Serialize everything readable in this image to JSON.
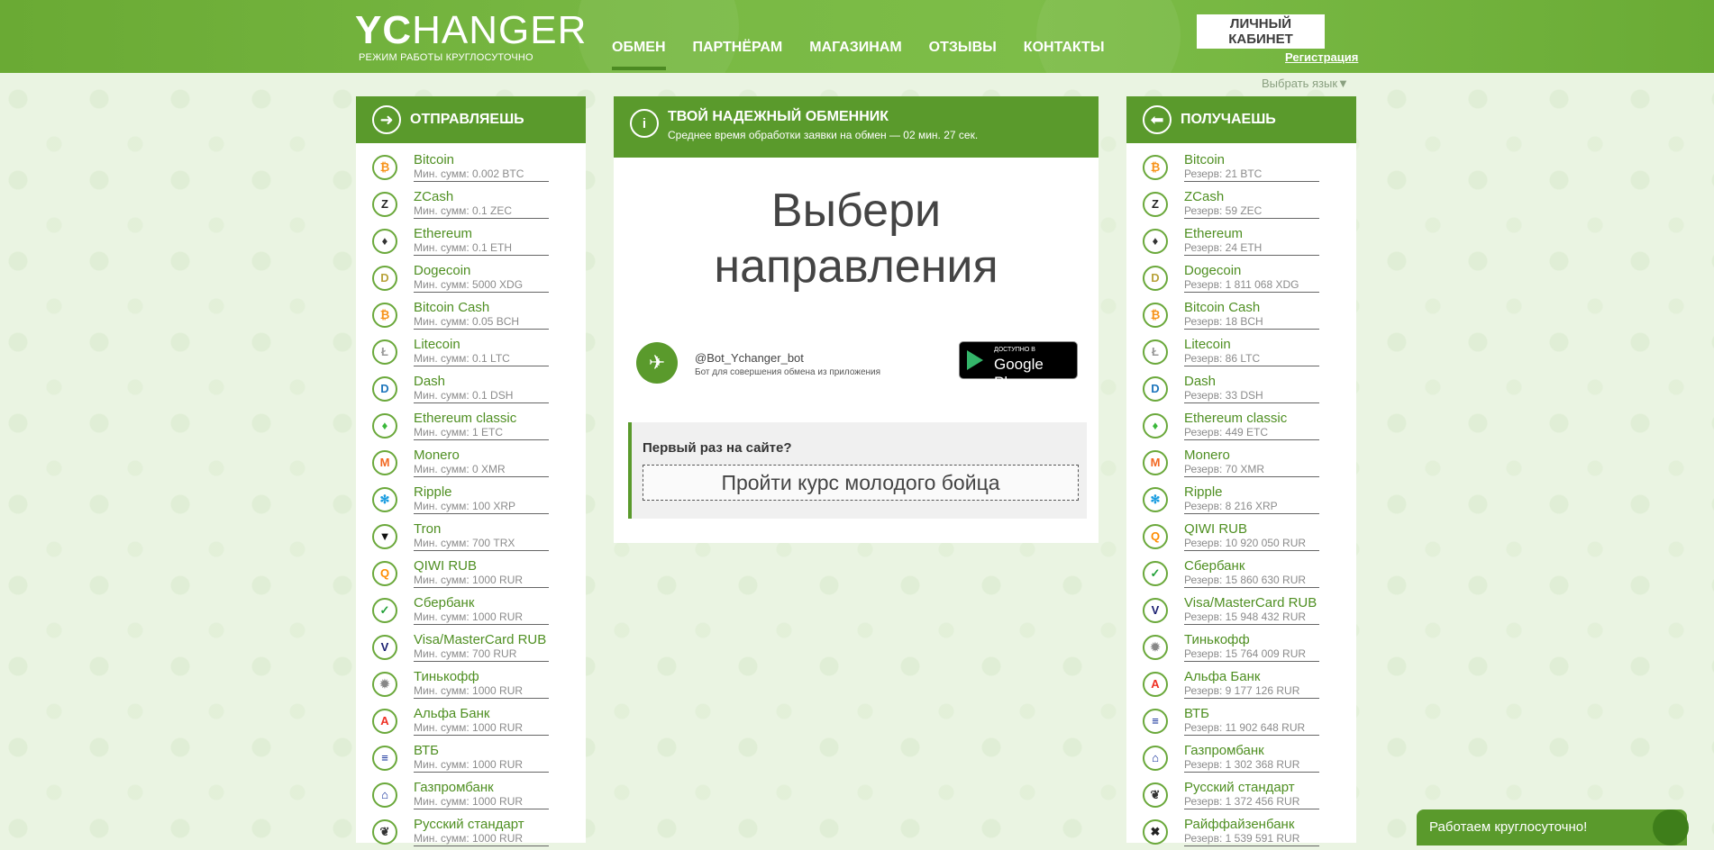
{
  "header": {
    "logo_bold": "YC",
    "logo_rest": "HANGER",
    "tagline": "РЕЖИМ РАБОТЫ КРУГЛОСУТОЧНО",
    "nav": [
      "ОБМЕН",
      "ПАРТНЁРАМ",
      "МАГАЗИНАМ",
      "ОТЗЫВЫ",
      "КОНТАКТЫ"
    ],
    "cabinet": "ЛИЧНЫЙ КАБИНЕТ",
    "register": "Регистрация",
    "lang": "Выбрать язык▼"
  },
  "send": {
    "title": "ОТПРАВЛЯЕШЬ",
    "items": [
      {
        "name": "Bitcoin",
        "sub": "Мин. сумм: 0.002 BTC",
        "icon": "bitcoin-icon",
        "glyph": "₿",
        "color": "#f7931a"
      },
      {
        "name": "ZCash",
        "sub": "Мин. сумм: 0.1 ZEC",
        "icon": "zcash-icon",
        "glyph": "Z",
        "color": "#222222"
      },
      {
        "name": "Ethereum",
        "sub": "Мин. сумм: 0.1 ETH",
        "icon": "ethereum-icon",
        "glyph": "♦",
        "color": "#333333"
      },
      {
        "name": "Dogecoin",
        "sub": "Мин. сумм: 5000 XDG",
        "icon": "dogecoin-icon",
        "glyph": "D",
        "color": "#b8a23a"
      },
      {
        "name": "Bitcoin Cash",
        "sub": "Мин. сумм: 0.05 BCH",
        "icon": "bitcoin-cash-icon",
        "glyph": "₿",
        "color": "#f7931a"
      },
      {
        "name": "Litecoin",
        "sub": "Мин. сумм: 0.1 LTC",
        "icon": "litecoin-icon",
        "glyph": "Ł",
        "color": "#999999"
      },
      {
        "name": "Dash",
        "sub": "Мин. сумм: 0.1 DSH",
        "icon": "dash-icon",
        "glyph": "D",
        "color": "#1c75bc"
      },
      {
        "name": "Ethereum classic",
        "sub": "Мин. сумм: 1 ETC",
        "icon": "ethereum-classic-icon",
        "glyph": "♦",
        "color": "#3ab83a"
      },
      {
        "name": "Monero",
        "sub": "Мин. сумм: 0 XMR",
        "icon": "monero-icon",
        "glyph": "M",
        "color": "#f26822"
      },
      {
        "name": "Ripple",
        "sub": "Мин. сумм: 100 XRP",
        "icon": "ripple-icon",
        "glyph": "✻",
        "color": "#1a9ce0"
      },
      {
        "name": "Tron",
        "sub": "Мин. сумм: 700 TRX",
        "icon": "tron-icon",
        "glyph": "▼",
        "color": "#111111"
      },
      {
        "name": "QIWI RUB",
        "sub": "Мин. сумм: 1000 RUR",
        "icon": "qiwi-icon",
        "glyph": "Q",
        "color": "#ff8c00"
      },
      {
        "name": "Сбербанк",
        "sub": "Мин. сумм: 1000 RUR",
        "icon": "sberbank-icon",
        "glyph": "✓",
        "color": "#21a038"
      },
      {
        "name": "Visa/MasterCard RUB",
        "sub": "Мин. сумм: 700 RUR",
        "icon": "visa-mastercard-icon",
        "glyph": "V",
        "color": "#1a1f71"
      },
      {
        "name": "Тинькофф",
        "sub": "Мин. сумм: 1000 RUR",
        "icon": "tinkoff-icon",
        "glyph": "✹",
        "color": "#888888"
      },
      {
        "name": "Альфа Банк",
        "sub": "Мин. сумм: 1000 RUR",
        "icon": "alfa-bank-icon",
        "glyph": "A",
        "color": "#ef3124"
      },
      {
        "name": "ВТБ",
        "sub": "Мин. сумм: 1000 RUR",
        "icon": "vtb-icon",
        "glyph": "≡",
        "color": "#0a2896"
      },
      {
        "name": "Газпромбанк",
        "sub": "Мин. сумм: 1000 RUR",
        "icon": "gazprombank-icon",
        "glyph": "⌂",
        "color": "#0a2896"
      },
      {
        "name": "Русский стандарт",
        "sub": "Мин. сумм: 1000 RUR",
        "icon": "russian-standard-icon",
        "glyph": "❦",
        "color": "#333333"
      }
    ]
  },
  "receive": {
    "title": "ПОЛУЧАЕШЬ",
    "items": [
      {
        "name": "Bitcoin",
        "sub": "Резерв: 21 BTC",
        "icon": "bitcoin-icon",
        "glyph": "₿",
        "color": "#f7931a"
      },
      {
        "name": "ZCash",
        "sub": "Резерв: 59 ZEC",
        "icon": "zcash-icon",
        "glyph": "Z",
        "color": "#222222"
      },
      {
        "name": "Ethereum",
        "sub": "Резерв: 24 ETH",
        "icon": "ethereum-icon",
        "glyph": "♦",
        "color": "#333333"
      },
      {
        "name": "Dogecoin",
        "sub": "Резерв: 1 811 068 XDG",
        "icon": "dogecoin-icon",
        "glyph": "D",
        "color": "#b8a23a"
      },
      {
        "name": "Bitcoin Cash",
        "sub": "Резерв: 18 BCH",
        "icon": "bitcoin-cash-icon",
        "glyph": "₿",
        "color": "#f7931a"
      },
      {
        "name": "Litecoin",
        "sub": "Резерв: 86 LTC",
        "icon": "litecoin-icon",
        "glyph": "Ł",
        "color": "#999999"
      },
      {
        "name": "Dash",
        "sub": "Резерв: 33 DSH",
        "icon": "dash-icon",
        "glyph": "D",
        "color": "#1c75bc"
      },
      {
        "name": "Ethereum classic",
        "sub": "Резерв: 449 ETC",
        "icon": "ethereum-classic-icon",
        "glyph": "♦",
        "color": "#3ab83a"
      },
      {
        "name": "Monero",
        "sub": "Резерв: 70 XMR",
        "icon": "monero-icon",
        "glyph": "M",
        "color": "#f26822"
      },
      {
        "name": "Ripple",
        "sub": "Резерв: 8 216 XRP",
        "icon": "ripple-icon",
        "glyph": "✻",
        "color": "#1a9ce0"
      },
      {
        "name": "QIWI RUB",
        "sub": "Резерв: 10 920 050 RUR",
        "icon": "qiwi-icon",
        "glyph": "Q",
        "color": "#ff8c00"
      },
      {
        "name": "Сбербанк",
        "sub": "Резерв: 15 860 630 RUR",
        "icon": "sberbank-icon",
        "glyph": "✓",
        "color": "#21a038"
      },
      {
        "name": "Visa/MasterCard RUB",
        "sub": "Резерв: 15 948 432 RUR",
        "icon": "visa-mastercard-icon",
        "glyph": "V",
        "color": "#1a1f71"
      },
      {
        "name": "Тинькофф",
        "sub": "Резерв: 15 764 009 RUR",
        "icon": "tinkoff-icon",
        "glyph": "✹",
        "color": "#888888"
      },
      {
        "name": "Альфа Банк",
        "sub": "Резерв: 9 177 126 RUR",
        "icon": "alfa-bank-icon",
        "glyph": "A",
        "color": "#ef3124"
      },
      {
        "name": "ВТБ",
        "sub": "Резерв: 11 902 648 RUR",
        "icon": "vtb-icon",
        "glyph": "≡",
        "color": "#0a2896"
      },
      {
        "name": "Газпромбанк",
        "sub": "Резерв: 1 302 368 RUR",
        "icon": "gazprombank-icon",
        "glyph": "⌂",
        "color": "#0a2896"
      },
      {
        "name": "Русский стандарт",
        "sub": "Резерв: 1 372 456 RUR",
        "icon": "russian-standard-icon",
        "glyph": "❦",
        "color": "#333333"
      },
      {
        "name": "Райффайзенбанк",
        "sub": "Резерв: 1 539 591 RUR",
        "icon": "raiffeisen-icon",
        "glyph": "✖",
        "color": "#222222"
      }
    ]
  },
  "center": {
    "title": "ТВОЙ НАДЕЖНЫЙ ОБМЕННИК",
    "subtitle": "Среднее время обработки заявки на обмен — 02 мин. 27 сек.",
    "choose_line1": "Выбери",
    "choose_line2": "направления",
    "bot_name": "@Bot_Ychanger_bot",
    "bot_desc": "Бот для совершения обмена из приложения",
    "gplay_small": "ДОСТУПНО В",
    "gplay_big": "Google Play",
    "first_q": "Первый раз на сайте?",
    "course": "Пройти курс молодого бойца"
  },
  "chat": "Работаем круглосуточно!"
}
